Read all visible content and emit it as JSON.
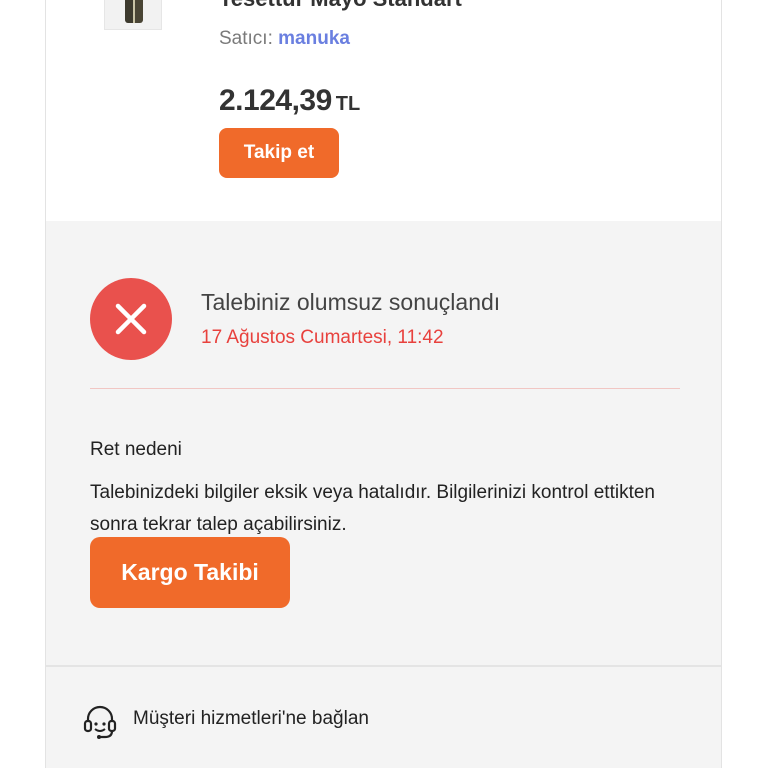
{
  "product": {
    "title": "Tesettür Mayo Standart",
    "seller_label": "Satıcı:",
    "seller_name": "manuka",
    "price_amount": "2.124,39",
    "price_currency": "TL",
    "follow_label": "Takip et"
  },
  "result": {
    "status_title": "Talebiniz olumsuz sonuçlandı",
    "status_date": "17 Ağustos Cumartesi, 11:42",
    "reason_label": "Ret nedeni",
    "reason_text": "Talebinizdeki bilgiler eksik veya hatalıdır. Bilgilerinizi kontrol ettikten sonra tekrar talep açabilirsiniz.",
    "cargo_button_label": "Kargo Takibi"
  },
  "support": {
    "label": "Müşteri hizmetleri'ne bağlan"
  },
  "colors": {
    "accent": "#f06a2a",
    "error": "#e9514d",
    "error_text": "#e8413d",
    "seller_link": "#6a7fe0"
  },
  "icons": {
    "error": "close-icon",
    "support": "headset-icon"
  }
}
